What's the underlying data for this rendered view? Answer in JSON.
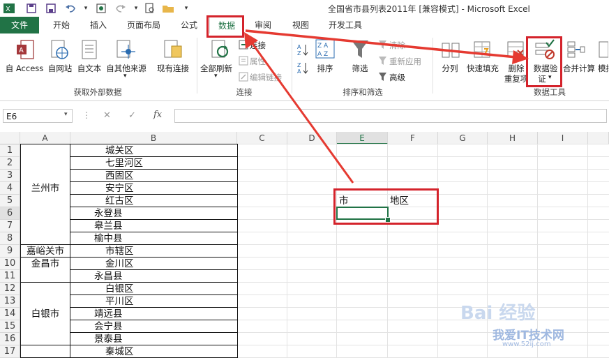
{
  "window": {
    "title": "全国省市县列表2011年  [兼容模式] - Microsoft Excel",
    "app_icon": "excel-icon"
  },
  "tabs": [
    "文件",
    "开始",
    "插入",
    "页面布局",
    "公式",
    "数据",
    "审阅",
    "视图",
    "开发工具"
  ],
  "active_tab": "数据",
  "ribbon": {
    "groups": {
      "external": "获取外部数据",
      "connections": "连接",
      "sort_filter": "排序和筛选",
      "data_tools": "数据工具"
    },
    "buttons": {
      "from_access": "自 Access",
      "from_web": "自网站",
      "from_text": "自文本",
      "from_other": "自其他来源",
      "existing": "现有连接",
      "refresh_all": "全部刷新",
      "connections": "连接",
      "properties": "属性",
      "edit_links": "编辑链接",
      "sort": "排序",
      "filter": "筛选",
      "clear": "清除",
      "reapply": "重新应用",
      "advanced": "高级",
      "split": "分列",
      "flash_fill": "快速填充",
      "remove_dup_1": "删除",
      "remove_dup_2": "重复项",
      "validation_1": "数据验",
      "validation_2": "证",
      "consolidate": "合并计算",
      "whatif": "模拟"
    }
  },
  "formula_bar": {
    "name_box": "E6",
    "fx": "fx",
    "cancel": "✕",
    "enter": "✓"
  },
  "columns": [
    "A",
    "B",
    "C",
    "D",
    "E",
    "F",
    "G",
    "H",
    "I"
  ],
  "rows": [
    "1",
    "2",
    "3",
    "4",
    "5",
    "6",
    "7",
    "8",
    "9",
    "10",
    "11",
    "12",
    "13",
    "14",
    "15",
    "16",
    "17"
  ],
  "col_a": [
    {
      "text": "兰州市",
      "row": 4
    },
    {
      "text": "嘉峪关市",
      "row": 9
    },
    {
      "text": "金昌市",
      "row": 10
    },
    {
      "text": "白银市",
      "row": 14
    }
  ],
  "col_b": [
    "城关区",
    "七里河区",
    "西固区",
    "安宁区",
    "红古区",
    "永登县",
    "皋兰县",
    "榆中县",
    "市辖区",
    "金川区",
    "永昌县",
    "白银区",
    "平川区",
    "靖远县",
    "会宁县",
    "景泰县",
    "秦城区"
  ],
  "e5": "市",
  "f5": "地区",
  "watermark": {
    "brand": "Bai 经验",
    "site": "我爱IT技术网",
    "url": "www.52ij.com"
  }
}
